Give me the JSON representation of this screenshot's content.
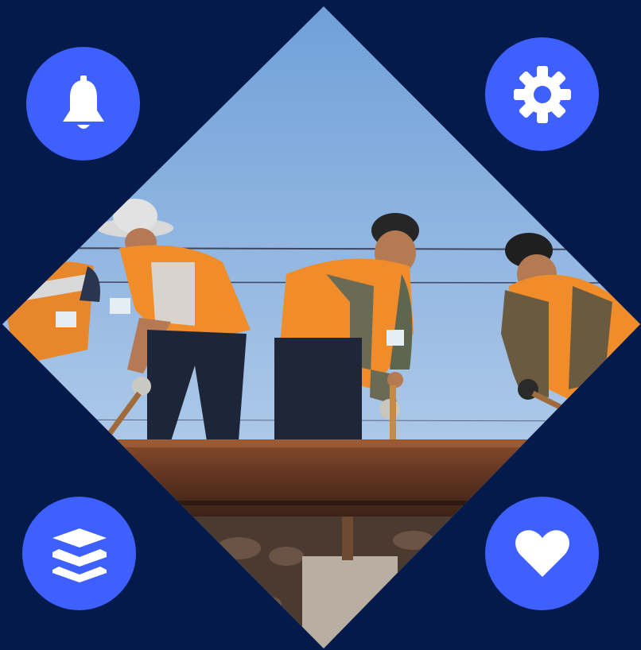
{
  "colors": {
    "background": "#031a4b",
    "button": "#3e60ff",
    "icon": "#ffffff",
    "sky_top": "#6f9fd8",
    "sky_bottom": "#c9dcf0",
    "vest": "#f28c28",
    "rail": "#6b3a24",
    "ballast": "#4a3a30"
  },
  "photo": {
    "subject": "railway-workers-photo"
  },
  "buttons": [
    {
      "id": "notifications",
      "icon": "bell-icon"
    },
    {
      "id": "settings",
      "icon": "gear-icon"
    },
    {
      "id": "layers",
      "icon": "layers-icon"
    },
    {
      "id": "favorites",
      "icon": "heart-icon"
    }
  ]
}
